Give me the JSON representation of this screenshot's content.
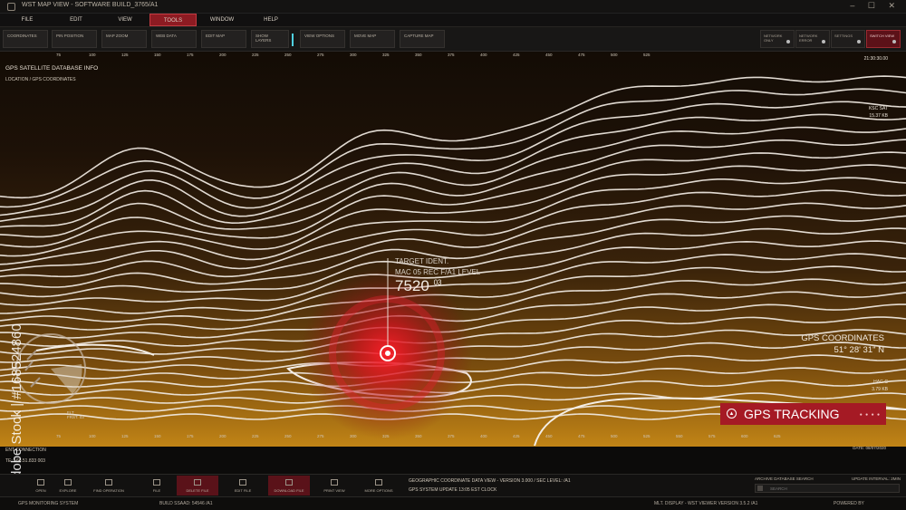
{
  "window": {
    "title": "WST MAP VIEW - SOFTWARE BUILD_3765/A1",
    "controls": "–  ☐  ✕"
  },
  "menu": [
    {
      "label": "FILE",
      "active": false
    },
    {
      "label": "EDIT",
      "active": false
    },
    {
      "label": "VIEW",
      "active": false
    },
    {
      "label": "TOOLS",
      "active": true
    },
    {
      "label": "WINDOW",
      "active": false
    },
    {
      "label": "HELP",
      "active": false
    }
  ],
  "toolbar": {
    "tools": [
      "COORDINATES",
      "PIN POSITION",
      "MAP ZOOM",
      "WEB DATA",
      "EDIT MAP",
      "SHOW LAYERS",
      "VIEW OPTIONS",
      "MOVE MAP",
      "CAPTURE MAP"
    ],
    "network": [
      {
        "label": "NETWORK ONLY"
      },
      {
        "label": "NETWORK ERROR"
      },
      {
        "label": "SETTINGS"
      },
      {
        "label": "SWITCH VIEW"
      }
    ]
  },
  "ruler_top": [
    "75",
    "100",
    "125",
    "150",
    "175",
    "200",
    "225",
    "250",
    "275",
    "300",
    "325",
    "350",
    "375",
    "400",
    "425",
    "450",
    "475",
    "500",
    "525"
  ],
  "ruler_bottom": [
    "75",
    "100",
    "125",
    "150",
    "175",
    "200",
    "225",
    "250",
    "275",
    "300",
    "325",
    "350",
    "375",
    "400",
    "425",
    "450",
    "475",
    "500",
    "525",
    "550",
    "575",
    "600",
    "625"
  ],
  "panel": {
    "title": "GPS SATELLITE DATABASE INFO",
    "subtitle": "LOCATION / GPS COORDINATES"
  },
  "target": {
    "ident": "TARGET IDENT.",
    "mac": "MAC 05 REC F/A1 LEVEL",
    "value": "7520",
    "sup": "03"
  },
  "gps": {
    "label": "GPS COORDINATES",
    "value": "51° 28' 31\" N"
  },
  "side": {
    "top_time": "21:30:30.00",
    "ksc": "KSC SAT",
    "ksc_size": "15.37 KB",
    "hac": "HAC-C",
    "hac_size": "3.79 KB"
  },
  "tracking": {
    "label": "GPS TRACKING"
  },
  "flt": {
    "line1": "FLT",
    "line2": "FRST. 03"
  },
  "connection": {
    "line1": "ENT CONNECTION",
    "line2": "TE: 168.51.833 003"
  },
  "date": "DATE: 08/07/2020",
  "watermark_id": "Adobe Stock | #168524860",
  "bottom_buttons": [
    {
      "label": "OPEN",
      "red": false
    },
    {
      "label": "EXPLORE",
      "red": false
    },
    {
      "label": "FIND OPERATION",
      "red": false
    },
    {
      "label": "FILE",
      "red": false
    },
    {
      "label": "DELETE FILE",
      "red": true
    },
    {
      "label": "EDIT FILE",
      "red": false
    },
    {
      "label": "DOWNLOAD FILE",
      "red": true
    },
    {
      "label": "PRINT VIEW",
      "red": false
    },
    {
      "label": "MORE OPTIONS",
      "red": false
    }
  ],
  "geo": {
    "line1": "GEOGRAPHIC COORDINATE DATA VIEW - VERSION 3.000 / SEC LEVEL: /A1",
    "line2": "GPS SYSTEM UPDATE 13:05 EST CLOCK"
  },
  "archive": {
    "label": "ARCHIVE DATABASE SEARCH",
    "update": "UPDATE INTERVAL: 2MIN",
    "placeholder": "SEARCH"
  },
  "status": {
    "left": "GPS MONITORING SYSTEM",
    "build": "BUILD SSAAD: 54546 /A1",
    "right": "MLT. DISPLAY - WST VIEWER VERSION 3.5.2 /A1",
    "powered": "POWERED BY"
  }
}
